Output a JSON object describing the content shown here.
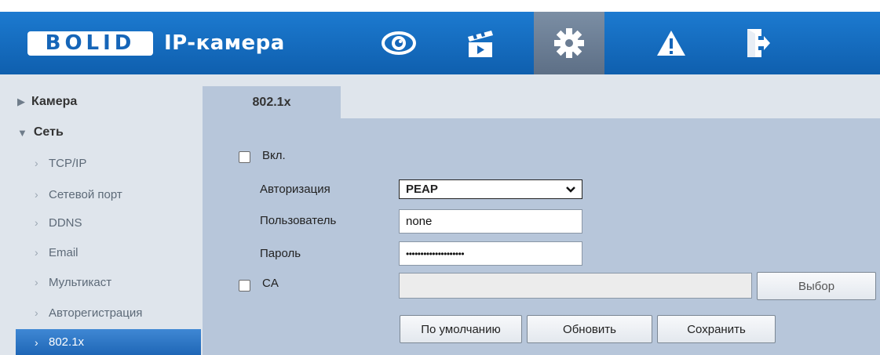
{
  "header": {
    "logo": "BOLID",
    "title": "IP-камера",
    "nav": [
      {
        "name": "live-view",
        "icon": "eye-icon"
      },
      {
        "name": "playback",
        "icon": "clapperboard-icon"
      },
      {
        "name": "settings",
        "icon": "gear-icon",
        "active": true
      },
      {
        "name": "alarm",
        "icon": "warning-icon"
      },
      {
        "name": "logout",
        "icon": "exit-icon"
      }
    ],
    "colors": {
      "bar": "#1565b8",
      "active": "#6b7d93"
    }
  },
  "sidebar": {
    "camera": "Камера",
    "network": "Сеть",
    "items": [
      "TCP/IP",
      "Сетевой порт",
      "DDNS",
      "Email",
      "Мультикаст",
      "Авторегистрация",
      "802.1x"
    ],
    "active_index": 6
  },
  "main": {
    "tab": "802.1x",
    "enable_label": "Вкл.",
    "enable_checked": false,
    "auth_label": "Авторизация",
    "auth_value": "PEAP",
    "user_label": "Пользователь",
    "user_value": "none",
    "password_label": "Пароль",
    "password_value": "••••••••••••••••••••",
    "ca_label": "CA",
    "ca_checked": false,
    "ca_value": "",
    "browse_label": "Выбор",
    "default_label": "По умолчанию",
    "refresh_label": "Обновить",
    "save_label": "Сохранить"
  }
}
